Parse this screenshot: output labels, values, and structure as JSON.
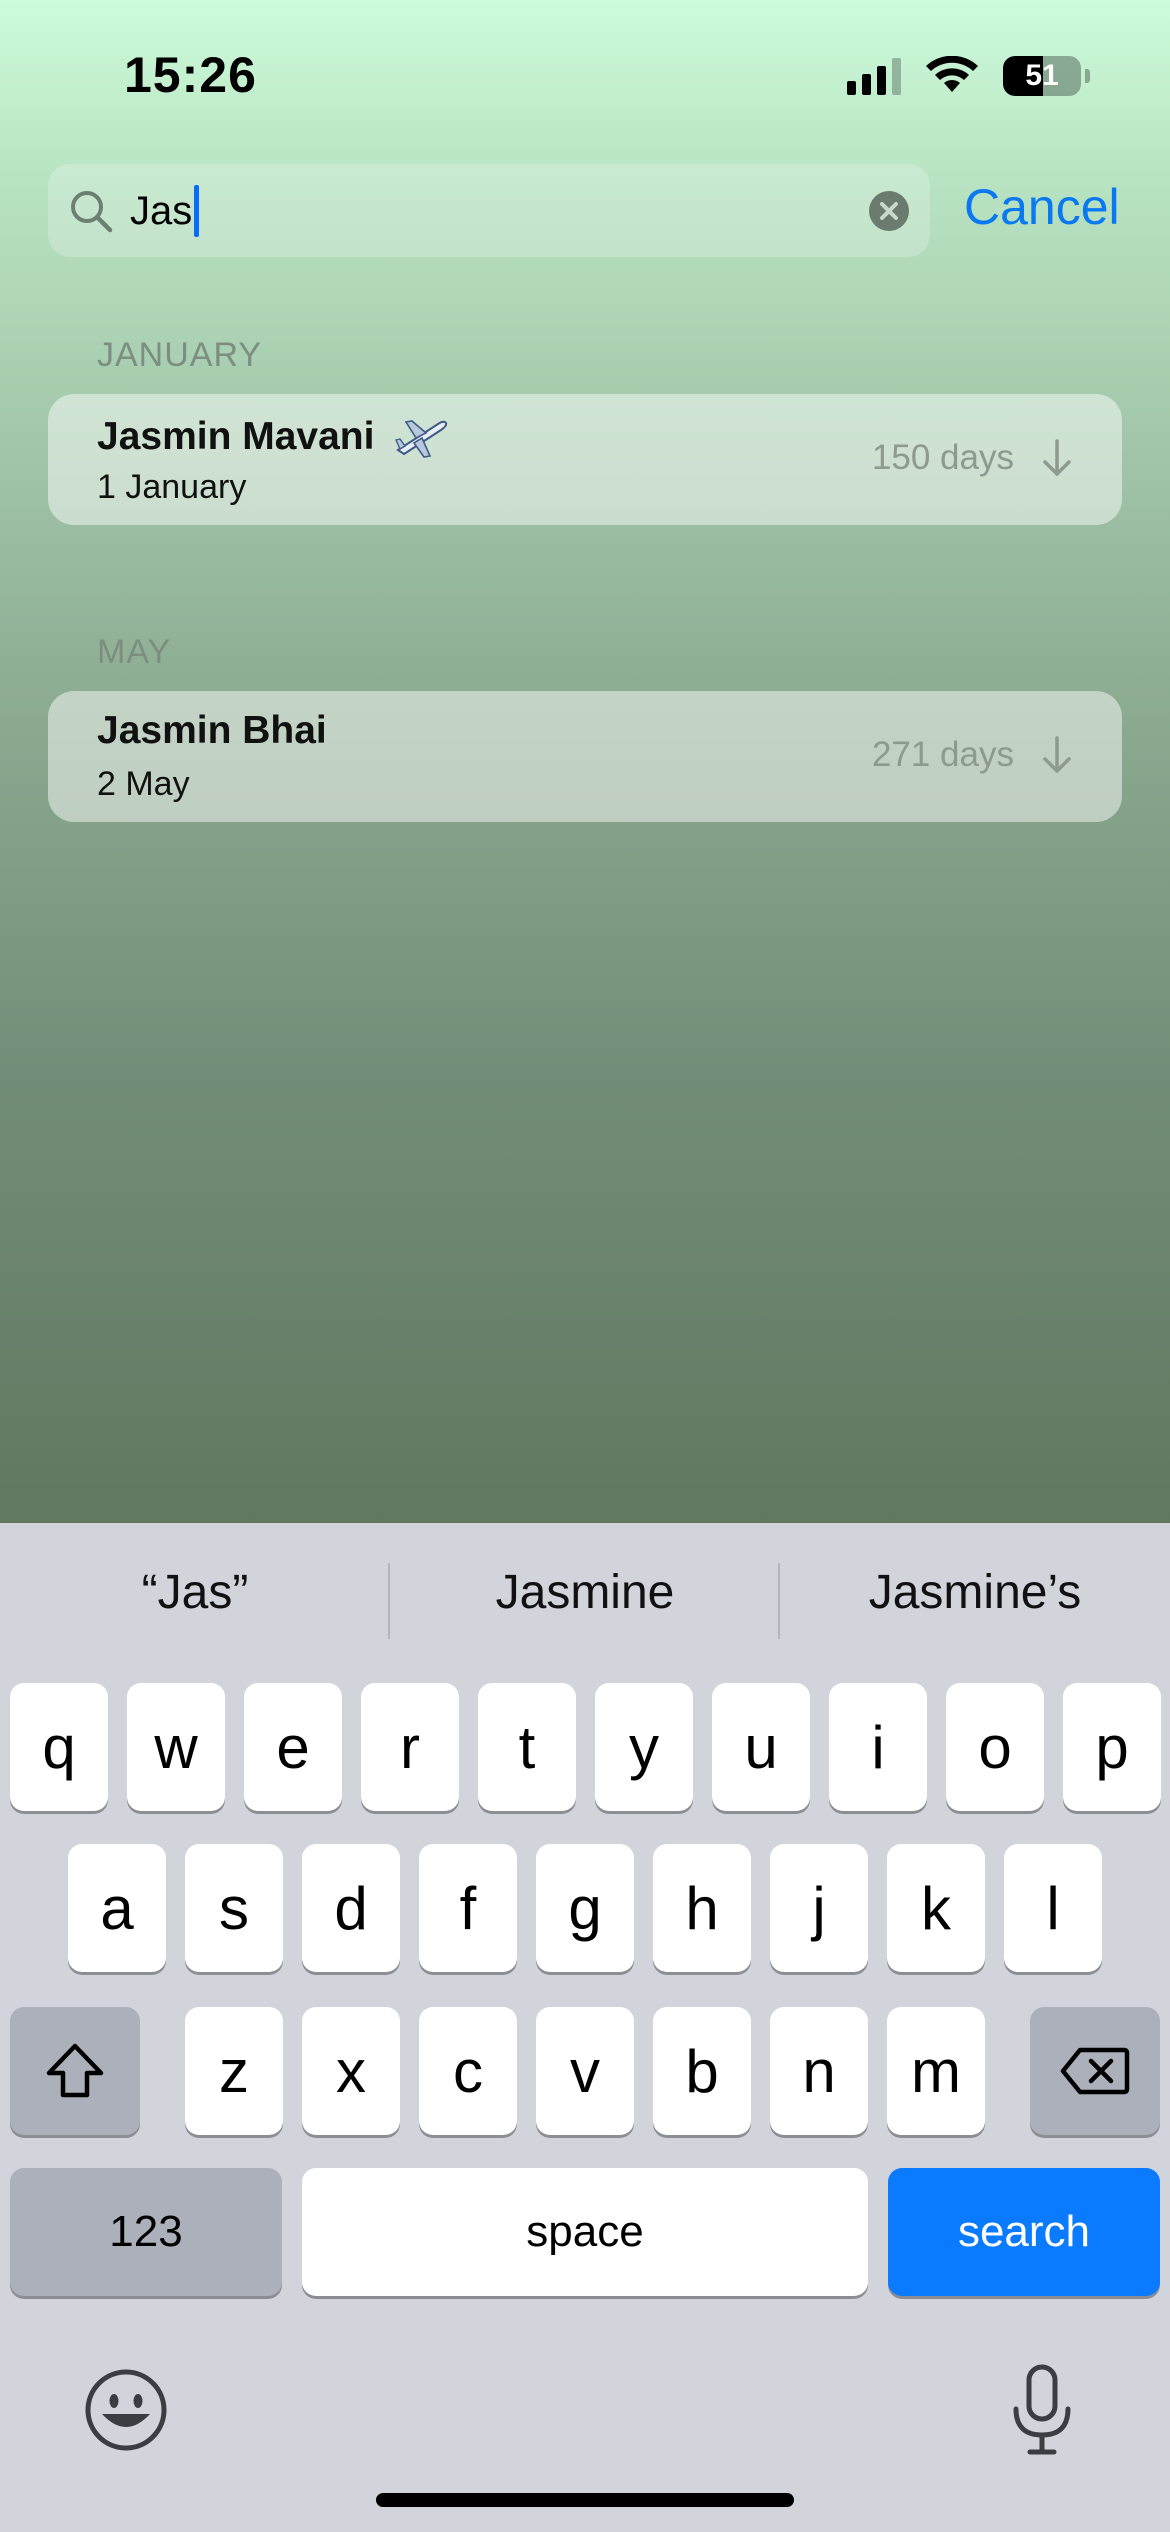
{
  "status_bar": {
    "time": "15:26",
    "battery": "51",
    "battery_fraction": 0.51
  },
  "search": {
    "query": "Jas",
    "cancel_label": "Cancel"
  },
  "sections": [
    {
      "header": "JANUARY",
      "items": [
        {
          "name": "Jasmin Mavani",
          "date": "1 January",
          "days": "150 days",
          "icon": "airplane-icon"
        }
      ]
    },
    {
      "header": "MAY",
      "items": [
        {
          "name": "Jasmin Bhai",
          "date": "2 May",
          "days": "271 days"
        }
      ]
    }
  ],
  "keyboard": {
    "suggestions": [
      "“Jas”",
      "Jasmine",
      "Jasmine’s"
    ],
    "row1": [
      "q",
      "w",
      "e",
      "r",
      "t",
      "y",
      "u",
      "i",
      "o",
      "p"
    ],
    "row2": [
      "a",
      "s",
      "d",
      "f",
      "g",
      "h",
      "j",
      "k",
      "l"
    ],
    "row3": [
      "z",
      "x",
      "c",
      "v",
      "b",
      "n",
      "m"
    ],
    "numbers_label": "123",
    "space_label": "space",
    "search_label": "search",
    "accent_color": "#0a7aff"
  }
}
